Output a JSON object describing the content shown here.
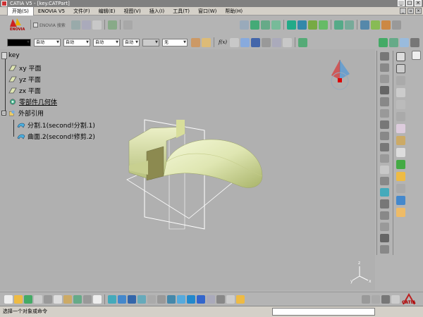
{
  "window": {
    "title": "CATIA V5 - [key.CATPart]"
  },
  "menubar": {
    "items": [
      {
        "label": "开始(S)"
      },
      {
        "label": "ENOVIA V5"
      },
      {
        "label": "文件(F)"
      },
      {
        "label": "编辑(E)"
      },
      {
        "label": "视图(V)"
      },
      {
        "label": "插入(I)"
      },
      {
        "label": "工具(T)"
      },
      {
        "label": "窗口(W)"
      },
      {
        "label": "帮助(H)"
      }
    ]
  },
  "toolbar_top": {
    "enovia_label": "ENOVIA",
    "enovia_search": "ENOVIA 搜索",
    "page_number": "2"
  },
  "toolbar_style": {
    "color_combo": "",
    "linetype_combo": "自动",
    "thickness_combo": "自动",
    "point_combo": "自动",
    "layer_combo": "自动",
    "pattern_combo": "",
    "none_combo": "无",
    "f_label": "f(x)"
  },
  "tree": {
    "root": "key",
    "items": [
      {
        "label": "xy 平面",
        "icon": "plane-icon"
      },
      {
        "label": "yz 平面",
        "icon": "plane-icon"
      },
      {
        "label": "zx 平面",
        "icon": "plane-icon"
      },
      {
        "label": "零部件几何体",
        "icon": "part-body-icon"
      },
      {
        "label": "外部引用",
        "icon": "external-refs-icon"
      },
      {
        "label": "分割.1(second!分割.1)",
        "icon": "surface-icon"
      },
      {
        "label": "曲面.2(second!修剪.2)",
        "icon": "surface-icon"
      }
    ]
  },
  "compass": {
    "x": "x",
    "y": "y",
    "z": "z"
  },
  "axis_triad": {
    "x": "x",
    "y": "y",
    "z": "z"
  },
  "statusbar": {
    "text": "选择一个对象或命令"
  },
  "logo": {
    "text": "CATIA"
  },
  "colors": {
    "surface": "#dfe6b2",
    "surface_shadow": "#a9b46a",
    "plane": "#ffffff",
    "background": "#b0b0b0"
  }
}
